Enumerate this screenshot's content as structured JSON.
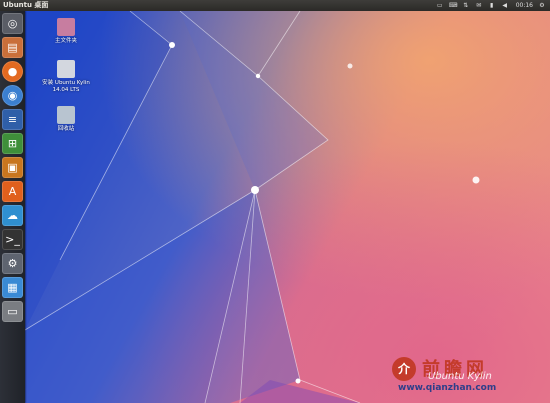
{
  "top_panel": {
    "title": "Ubuntu 桌面",
    "clock": "00:16",
    "indicators": [
      {
        "icon": "monitor-icon"
      },
      {
        "icon": "keyboard-icon"
      },
      {
        "icon": "network-icon"
      },
      {
        "icon": "email-icon"
      },
      {
        "icon": "battery-icon"
      },
      {
        "icon": "volume-icon"
      },
      {
        "icon": "session-icon"
      }
    ]
  },
  "launcher": {
    "items": [
      {
        "name": "dash-button",
        "icon": "ubuntu-dash-icon",
        "color": "#5a5d66"
      },
      {
        "name": "files",
        "icon": "file-manager-icon",
        "color": "#c96f3a"
      },
      {
        "name": "firefox",
        "icon": "firefox-icon",
        "color": "#e36a21"
      },
      {
        "name": "chromium",
        "icon": "browser-icon",
        "color": "#3b7fd0"
      },
      {
        "name": "writer",
        "icon": "writer-icon",
        "color": "#2f5fa8"
      },
      {
        "name": "calc",
        "icon": "spreadsheet-icon",
        "color": "#3f8f3a"
      },
      {
        "name": "impress",
        "icon": "presentation-icon",
        "color": "#c8761f"
      },
      {
        "name": "software-center",
        "icon": "software-center-icon",
        "color": "#e0601d"
      },
      {
        "name": "cloud",
        "icon": "cloud-icon",
        "color": "#2f8fd0"
      },
      {
        "name": "terminal",
        "icon": "terminal-icon",
        "color": "#333333"
      },
      {
        "name": "settings",
        "icon": "settings-icon",
        "color": "#5e6470"
      },
      {
        "name": "workspace",
        "icon": "workspace-switcher-icon",
        "color": "#3a8ad4"
      },
      {
        "name": "trash",
        "icon": "trash-icon",
        "color": "#7a7d82"
      }
    ]
  },
  "desktop": {
    "icons": [
      {
        "label": "主文件夹",
        "icon": "folder-icon",
        "color": "#c77da0"
      },
      {
        "label": "安装 Ubuntu Kylin\n14.04 LTS",
        "icon": "installer-icon",
        "color": "#d3d7df"
      },
      {
        "label": "回收站",
        "icon": "trash-icon",
        "color": "#b8c4d0"
      }
    ]
  },
  "watermark": {
    "title": "前瞻网",
    "logo_text": "介",
    "subtitle": "Ubuntu Kylin",
    "site": "www.qianzhan.com"
  },
  "colors": {
    "wallpaper_blue": "#2a55c8",
    "wallpaper_pink": "#e36b8a",
    "wallpaper_peach": "#f0a36e"
  }
}
